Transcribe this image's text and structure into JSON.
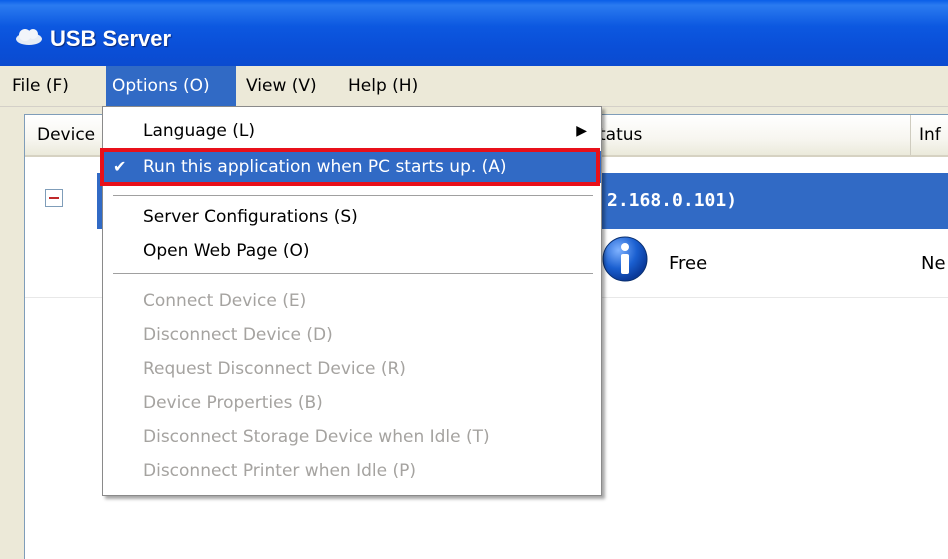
{
  "window": {
    "title": "USB Server",
    "icon": "cloud-icon"
  },
  "menubar": {
    "items": [
      {
        "label": "File (F)"
      },
      {
        "label": "Options (O)"
      },
      {
        "label": "View (V)"
      },
      {
        "label": "Help (H)"
      }
    ]
  },
  "table": {
    "columns": [
      {
        "label": "Device"
      },
      {
        "label": "tatus"
      },
      {
        "label": "Inf"
      }
    ],
    "server_row": {
      "text": "2.168.0.101)"
    },
    "device_row": {
      "status": "Free",
      "info": "Ne"
    }
  },
  "dropdown": {
    "items": [
      {
        "label": "Language (L)",
        "enabled": true,
        "has_submenu": true
      },
      {
        "label": "Run this application when PC starts up. (A)",
        "enabled": true,
        "checked": true,
        "highlighted": true
      },
      {
        "label": "Server Configurations (S)",
        "enabled": true
      },
      {
        "label": "Open Web Page (O)",
        "enabled": true
      },
      {
        "label": "Connect Device (E)",
        "enabled": false
      },
      {
        "label": "Disconnect Device (D)",
        "enabled": false
      },
      {
        "label": "Request Disconnect Device (R)",
        "enabled": false
      },
      {
        "label": "Device Properties (B)",
        "enabled": false
      },
      {
        "label": "Disconnect Storage Device when Idle (T)",
        "enabled": false
      },
      {
        "label": "Disconnect Printer when Idle (P)",
        "enabled": false
      }
    ]
  },
  "colors": {
    "selection": "#316ac5",
    "title_bar": "#0a4fd8",
    "highlight_border": "#e8101a"
  }
}
